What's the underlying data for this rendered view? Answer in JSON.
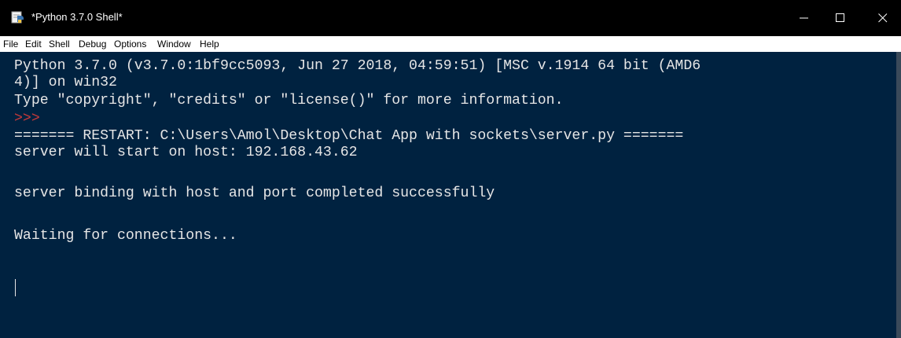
{
  "window": {
    "title": "*Python 3.7.0 Shell*",
    "controls": {
      "minimize": "—",
      "maximize": "☐",
      "close": "✕"
    }
  },
  "menu": [
    "File",
    "Edit",
    "Shell",
    "Debug",
    "Options",
    "Window",
    "Help"
  ],
  "shell": {
    "lines": [
      "Python 3.7.0 (v3.7.0:1bf9cc5093, Jun 27 2018, 04:59:51) [MSC v.1914 64 bit (AMD6",
      "4)] on win32",
      "Type \"copyright\", \"credits\" or \"license()\" for more information.",
      ">>> ",
      "======= RESTART: C:\\Users\\Amol\\Desktop\\Chat App with sockets\\server.py =======",
      "server will start on host: 192.168.43.62",
      "",
      "server binding with host and port completed successfully",
      "",
      "Waiting for connections..."
    ]
  },
  "colors": {
    "background": "#002240",
    "text": "#e6e6e6",
    "prompt": "#c73a3a",
    "titlebar": "#000000"
  },
  "icons": {
    "app": "python-idle-icon",
    "minimize": "minimize-icon",
    "maximize": "maximize-icon",
    "close": "close-icon"
  }
}
